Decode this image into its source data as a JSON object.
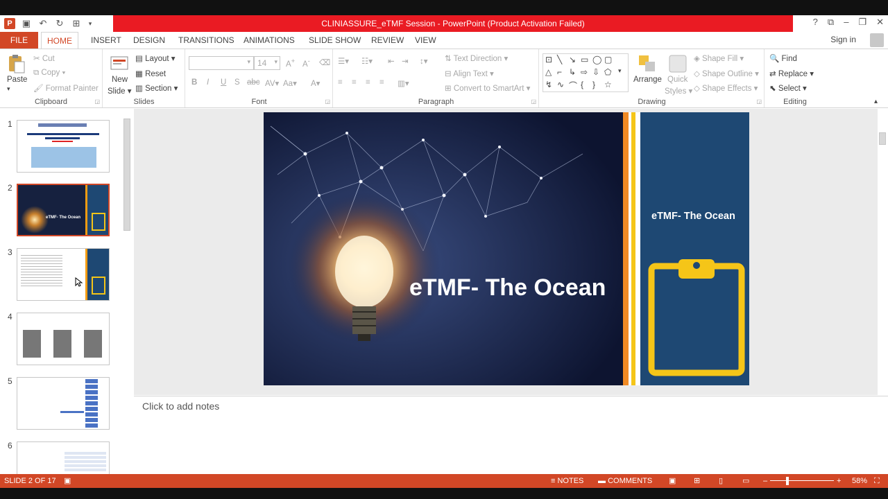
{
  "window": {
    "title": "CLINIASSURE_eTMF Session - PowerPoint (Product Activation Failed)",
    "app_icon": "P"
  },
  "tabs": [
    "FILE",
    "HOME",
    "INSERT",
    "DESIGN",
    "TRANSITIONS",
    "ANIMATIONS",
    "SLIDE SHOW",
    "REVIEW",
    "VIEW"
  ],
  "account": {
    "sign_in": "Sign in"
  },
  "ribbon": {
    "clipboard": {
      "label": "Clipboard",
      "paste": "Paste",
      "cut": "Cut",
      "copy": "Copy",
      "format_painter": "Format Painter"
    },
    "slides": {
      "label": "Slides",
      "new_slide_line1": "New",
      "new_slide_line2": "Slide",
      "layout": "Layout",
      "reset": "Reset",
      "section": "Section"
    },
    "font": {
      "label": "Font",
      "size": "14"
    },
    "paragraph": {
      "label": "Paragraph",
      "text_direction": "Text Direction",
      "align_text": "Align Text",
      "convert_smartart": "Convert to SmartArt"
    },
    "drawing": {
      "label": "Drawing",
      "arrange": "Arrange",
      "quick_styles_line1": "Quick",
      "quick_styles_line2": "Styles",
      "shape_fill": "Shape Fill",
      "shape_outline": "Shape Outline",
      "shape_effects": "Shape Effects"
    },
    "editing": {
      "label": "Editing",
      "find": "Find",
      "replace": "Replace",
      "select": "Select"
    }
  },
  "thumbnails": [
    "1",
    "2",
    "3",
    "4",
    "5",
    "6"
  ],
  "slide": {
    "main_title": "eTMF- The Ocean",
    "side_title": "eTMF- The Ocean"
  },
  "notes": {
    "placeholder": "Click to add notes"
  },
  "status": {
    "slide_count": "SLIDE 2 OF 17",
    "notes": "NOTES",
    "comments": "COMMENTS",
    "zoom": "58%"
  },
  "colors": {
    "accent": "#d24726",
    "title_red": "#ea1b23",
    "slide_panel": "#1e4873",
    "clipboard_yellow": "#f5c518"
  }
}
